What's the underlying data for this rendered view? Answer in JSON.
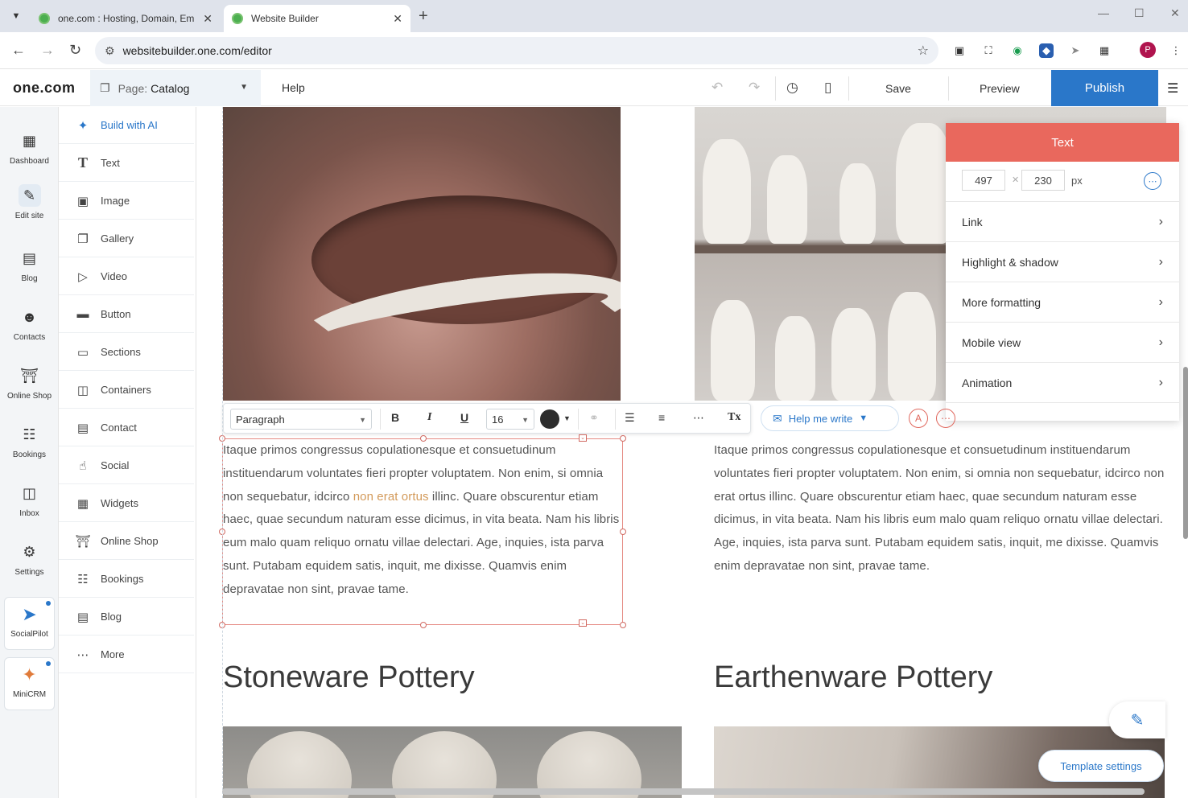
{
  "browser": {
    "tabs": [
      {
        "title": "one.com : Hosting, Domain, Em",
        "active": false
      },
      {
        "title": "Website Builder",
        "active": true
      }
    ],
    "url": "websitebuilder.one.com/editor",
    "profile_initial": "P"
  },
  "header": {
    "logo": "one.com",
    "page_label": "Page:",
    "page_name": "Catalog",
    "help": "Help",
    "save": "Save",
    "preview": "Preview",
    "publish": "Publish",
    "accent_color": "#2a77c9"
  },
  "rail": {
    "items": [
      {
        "label": "Dashboard",
        "icon": "dashboard-icon"
      },
      {
        "label": "Edit site",
        "icon": "edit-site-icon"
      },
      {
        "label": "Blog",
        "icon": "blog-icon"
      },
      {
        "label": "Contacts",
        "icon": "contacts-icon"
      },
      {
        "label": "Online Shop",
        "icon": "shop-icon"
      },
      {
        "label": "Bookings",
        "icon": "bookings-icon"
      },
      {
        "label": "Inbox",
        "icon": "inbox-icon"
      },
      {
        "label": "Settings",
        "icon": "gear-icon"
      }
    ],
    "apps": [
      {
        "label": "SocialPilot"
      },
      {
        "label": "MiniCRM"
      }
    ]
  },
  "widgets": [
    {
      "label": "Build with AI",
      "icon": "sparkle-icon"
    },
    {
      "label": "Text",
      "icon": "text-icon"
    },
    {
      "label": "Image",
      "icon": "image-icon"
    },
    {
      "label": "Gallery",
      "icon": "gallery-icon"
    },
    {
      "label": "Video",
      "icon": "video-icon"
    },
    {
      "label": "Button",
      "icon": "button-icon"
    },
    {
      "label": "Sections",
      "icon": "sections-icon"
    },
    {
      "label": "Containers",
      "icon": "containers-icon"
    },
    {
      "label": "Contact",
      "icon": "contact-icon"
    },
    {
      "label": "Social",
      "icon": "social-icon"
    },
    {
      "label": "Widgets",
      "icon": "widgets-icon"
    },
    {
      "label": "Online Shop",
      "icon": "cart-icon"
    },
    {
      "label": "Bookings",
      "icon": "bookings-icon"
    },
    {
      "label": "Blog",
      "icon": "blog-icon"
    },
    {
      "label": "More",
      "icon": "more-icon"
    }
  ],
  "toolbar": {
    "style": "Paragraph",
    "font_size": "16",
    "bold": "B",
    "italic": "I",
    "underline": "U",
    "clear": "Tx",
    "help_me_write": "Help me write",
    "text_color": "#2d2d2d"
  },
  "content": {
    "para_left_a": "Itaque primos congressus copulationesque et consuetudinum instituendarum voluntates fieri propter voluptatem. Non enim, si omnia non sequebatur, idcirco ",
    "para_left_link": "non erat ortus",
    "para_left_b": " illinc. Quare obscurentur etiam haec, quae secundum naturam esse dicimus, in vita beata. Nam his libris eum malo quam reliquo ornatu villae delectari. Age, inquies, ista parva sunt. Putabam equidem satis, inquit, me dixisse. Quamvis enim depravatae non sint, pravae tame.",
    "para_right": "Itaque primos congressus copulationesque et consuetudinum instituendarum voluntates fieri propter voluptatem. Non enim, si omnia non sequebatur, idcirco non erat ortus illinc. Quare obscurentur etiam haec, quae secundum naturam esse dicimus, in vita beata. Nam his libris eum malo quam reliquo ornatu villae delectari. Age, inquies, ista parva sunt. Putabam equidem satis, inquit, me dixisse. Quamvis enim depravatae non sint, pravae tame.",
    "heading_left": "Stoneware Pottery",
    "heading_right": "Earthenware Pottery",
    "link_color": "#d39a5a"
  },
  "panel": {
    "title": "Text",
    "width": "497",
    "height": "230",
    "unit": "px",
    "rows": [
      "Link",
      "Highlight & shadow",
      "More formatting",
      "Mobile view",
      "Animation"
    ],
    "header_color": "#e9685d"
  },
  "template_settings": "Template settings"
}
